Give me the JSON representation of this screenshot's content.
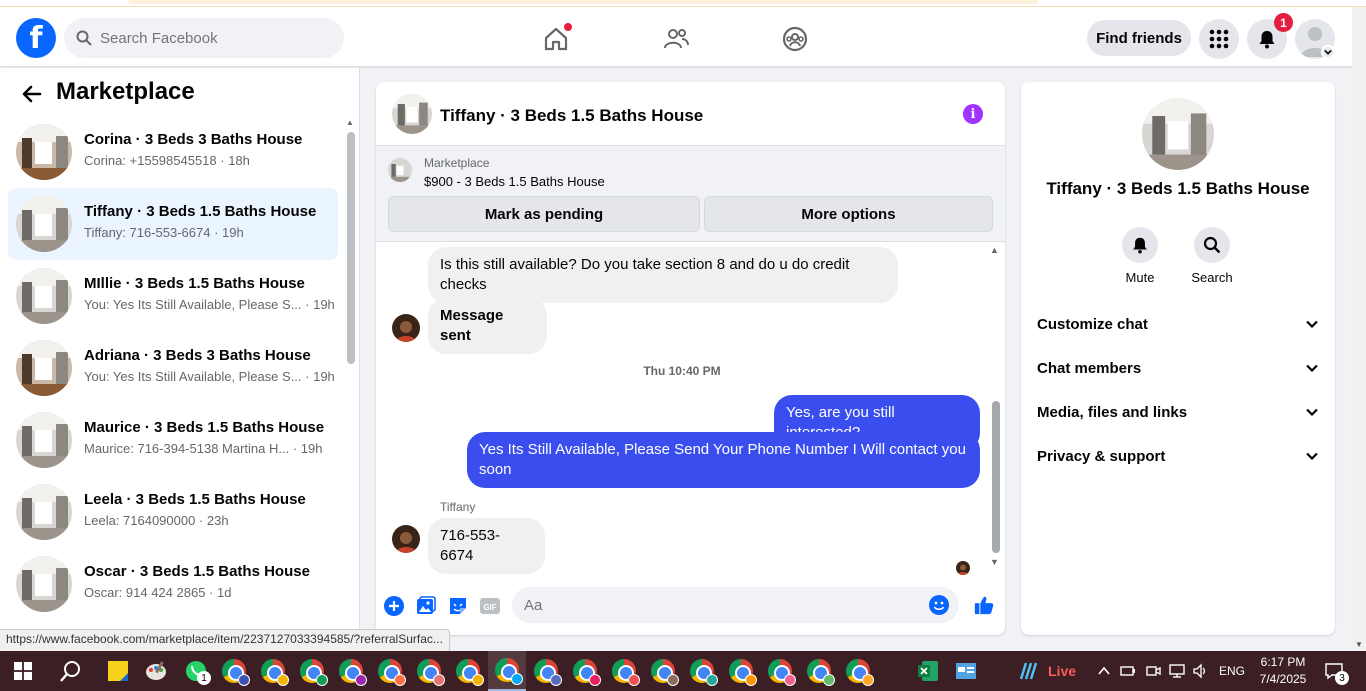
{
  "header": {
    "search_placeholder": "Search Facebook",
    "find_friends_label": "Find friends",
    "notification_count": "1"
  },
  "left_pane": {
    "title": "Marketplace",
    "conversations": [
      {
        "title": "Corina · 3 Beds 3 Baths House",
        "subtitle": "Corina: +15598545518 · 18h",
        "active": false
      },
      {
        "title": "Tiffany · 3 Beds 1.5 Baths House",
        "subtitle": "Tiffany: 716-553-6674 · 19h",
        "active": true
      },
      {
        "title": "MIllie · 3 Beds 1.5 Baths House",
        "subtitle": "You: Yes Its Still Available, Please S... · 19h",
        "active": false
      },
      {
        "title": "Adriana · 3 Beds 3 Baths House",
        "subtitle": "You: Yes Its Still Available, Please S... · 19h",
        "active": false
      },
      {
        "title": "Maurice · 3 Beds 1.5 Baths House",
        "subtitle": "Maurice: 716-394-5138 Martina H... · 19h",
        "active": false
      },
      {
        "title": "Leela · 3 Beds 1.5 Baths House",
        "subtitle": "Leela: 7164090000 · 23h",
        "active": false
      },
      {
        "title": "Oscar · 3 Beds 1.5 Baths House",
        "subtitle": "Oscar: 914 424 2865 · 1d",
        "active": false
      }
    ]
  },
  "chat": {
    "title": "Tiffany · 3 Beds 1.5 Baths House",
    "marketplace_label": "Marketplace",
    "listing": "$900 - 3 Beds 1.5 Baths House",
    "mark_pending_label": "Mark as pending",
    "more_options_label": "More options",
    "messages": {
      "m1": "Is this still available? Do you take section 8 and do u do credit checks",
      "m2": "Message sent",
      "timestamp": "Thu 10:40 PM",
      "m3": "Yes, are you still interested?",
      "m4": "Yes Its Still Available, Please Send Your Phone Number I Will contact you soon",
      "sender_name": "Tiffany",
      "m5": "716-553-6674"
    },
    "composer_placeholder": "Aa"
  },
  "right_pane": {
    "title": "Tiffany · 3 Beds 1.5 Baths House",
    "mute_label": "Mute",
    "search_label": "Search",
    "sections": [
      "Customize chat",
      "Chat members",
      "Media, files and links",
      "Privacy & support"
    ]
  },
  "status_url": "https://www.facebook.com/marketplace/item/2237127033394585/?referralSurfac...",
  "taskbar": {
    "live_label": "Live",
    "language": "ENG",
    "time": "6:17 PM",
    "date": "7/4/2025",
    "notification_count": "3",
    "whatsapp_badge": "1"
  },
  "colors": {
    "fb_blue": "#0866ff",
    "outgoing_bubble": "#3a4ef0",
    "active_conv_bg": "#ebf5ff",
    "info_purple": "#a033ff",
    "badge_red": "#e41e3f",
    "taskbar_bg": "#3c1f24"
  }
}
